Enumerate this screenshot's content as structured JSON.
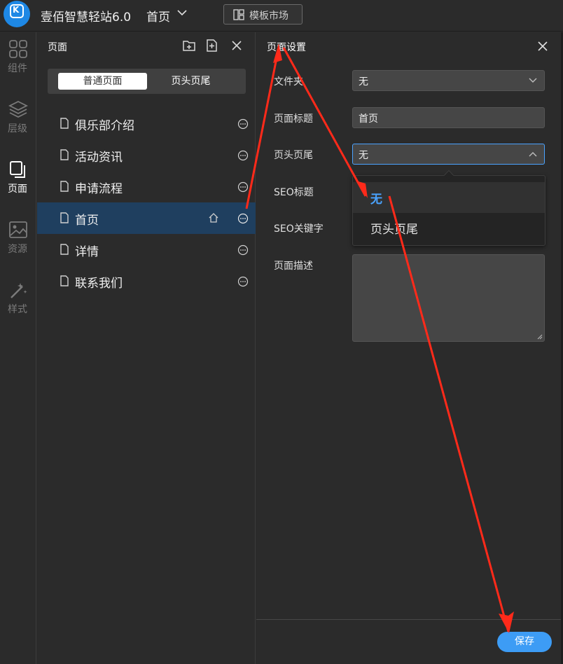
{
  "app": {
    "title": "壹佰智慧轻站6.0",
    "current_page": "首页",
    "template_market": "模板市场",
    "logo_text": "K"
  },
  "rail": [
    {
      "label": "组件",
      "icon": "components-grid-icon"
    },
    {
      "label": "层级",
      "icon": "layers-icon"
    },
    {
      "label": "页面",
      "icon": "pages-icon"
    },
    {
      "label": "资源",
      "icon": "image-resource-icon"
    },
    {
      "label": "样式",
      "icon": "magic-wand-style-icon"
    }
  ],
  "pages_panel": {
    "title": "页面",
    "tabs": [
      {
        "label": "普通页面",
        "active": true
      },
      {
        "label": "页头页尾",
        "active": false
      }
    ],
    "items": [
      {
        "name": "俱乐部介绍"
      },
      {
        "name": "活动资讯"
      },
      {
        "name": "申请流程"
      },
      {
        "name": "首页",
        "selected": true,
        "is_home": true
      },
      {
        "name": "详情"
      },
      {
        "name": "联系我们"
      }
    ]
  },
  "settings": {
    "title": "页面设置",
    "folder_label": "文件夹",
    "folder_value": "无",
    "page_title_label": "页面标题",
    "page_title_value": "首页",
    "header_footer_label": "页头页尾",
    "header_footer_value": "无",
    "seo_title_label": "SEO标题",
    "seo_keywords_label": "SEO关键字",
    "description_label": "页面描述",
    "description_value": "",
    "dropdown_options": [
      "无",
      "页头页尾"
    ],
    "save_label": "保存"
  },
  "colors": {
    "accent": "#3d9cf5",
    "selected_row": "#1f3f5f",
    "annotation_arrow": "#ff2a1a"
  }
}
